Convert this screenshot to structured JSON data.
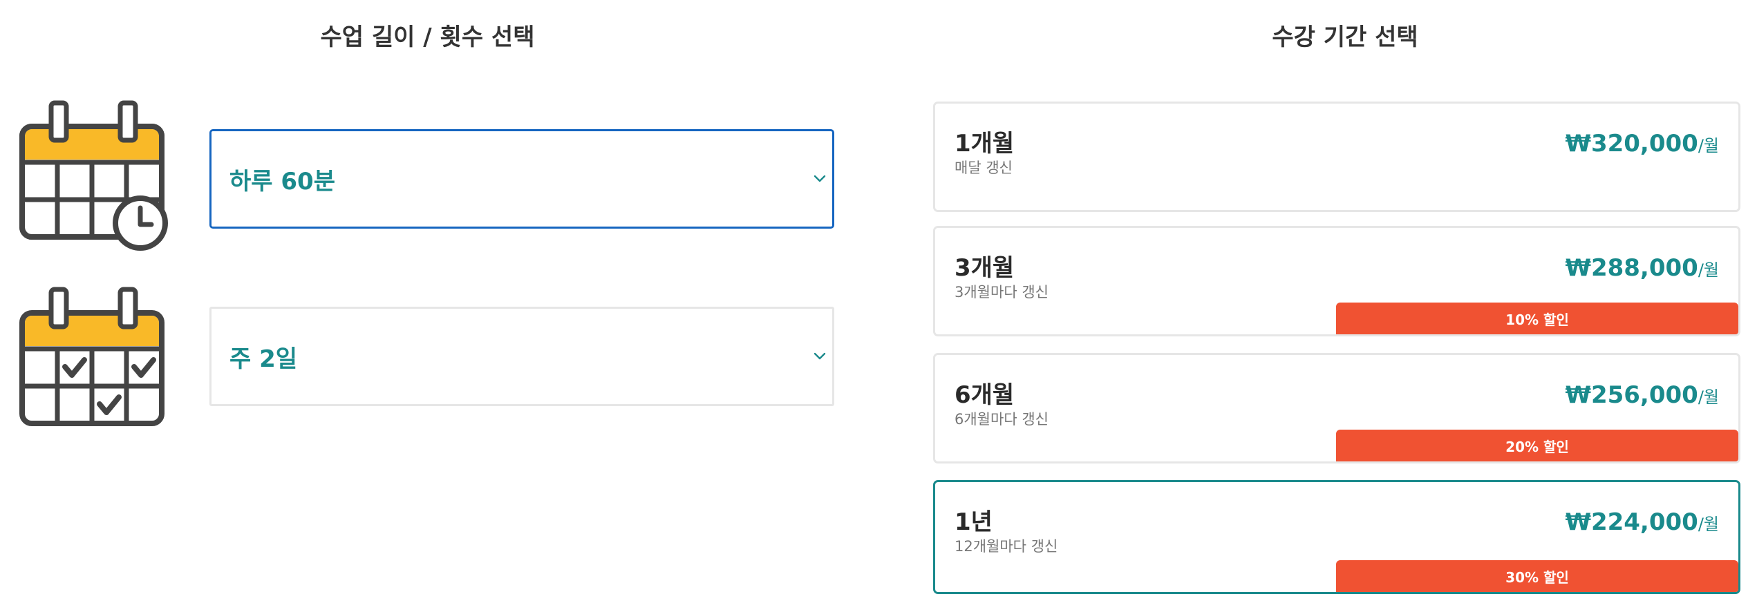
{
  "left": {
    "title": "수업 길이 / 횟수 선택",
    "duration_select": {
      "value": "하루 60분",
      "icon": "calendar-clock-icon"
    },
    "frequency_select": {
      "value": "주 2일",
      "icon": "calendar-check-icon"
    }
  },
  "right": {
    "title": "수강 기간 선택",
    "plans": [
      {
        "name": "1개월",
        "renewal": "매달 갱신",
        "price": "₩320,000",
        "unit": "/월",
        "discount": ""
      },
      {
        "name": "3개월",
        "renewal": "3개월마다 갱신",
        "price": "₩288,000",
        "unit": "/월",
        "discount": "10% 할인"
      },
      {
        "name": "6개월",
        "renewal": "6개월마다 갱신",
        "price": "₩256,000",
        "unit": "/월",
        "discount": "20% 할인"
      },
      {
        "name": "1년",
        "renewal": "12개월마다 갱신",
        "price": "₩224,000",
        "unit": "/월",
        "discount": "30% 할인",
        "selected": true
      }
    ]
  },
  "colors": {
    "accent_teal": "#1a8a8c",
    "focus_blue": "#1565c0",
    "discount_orange": "#f05232",
    "calendar_yellow": "#f9b928",
    "icon_dark": "#444444"
  }
}
